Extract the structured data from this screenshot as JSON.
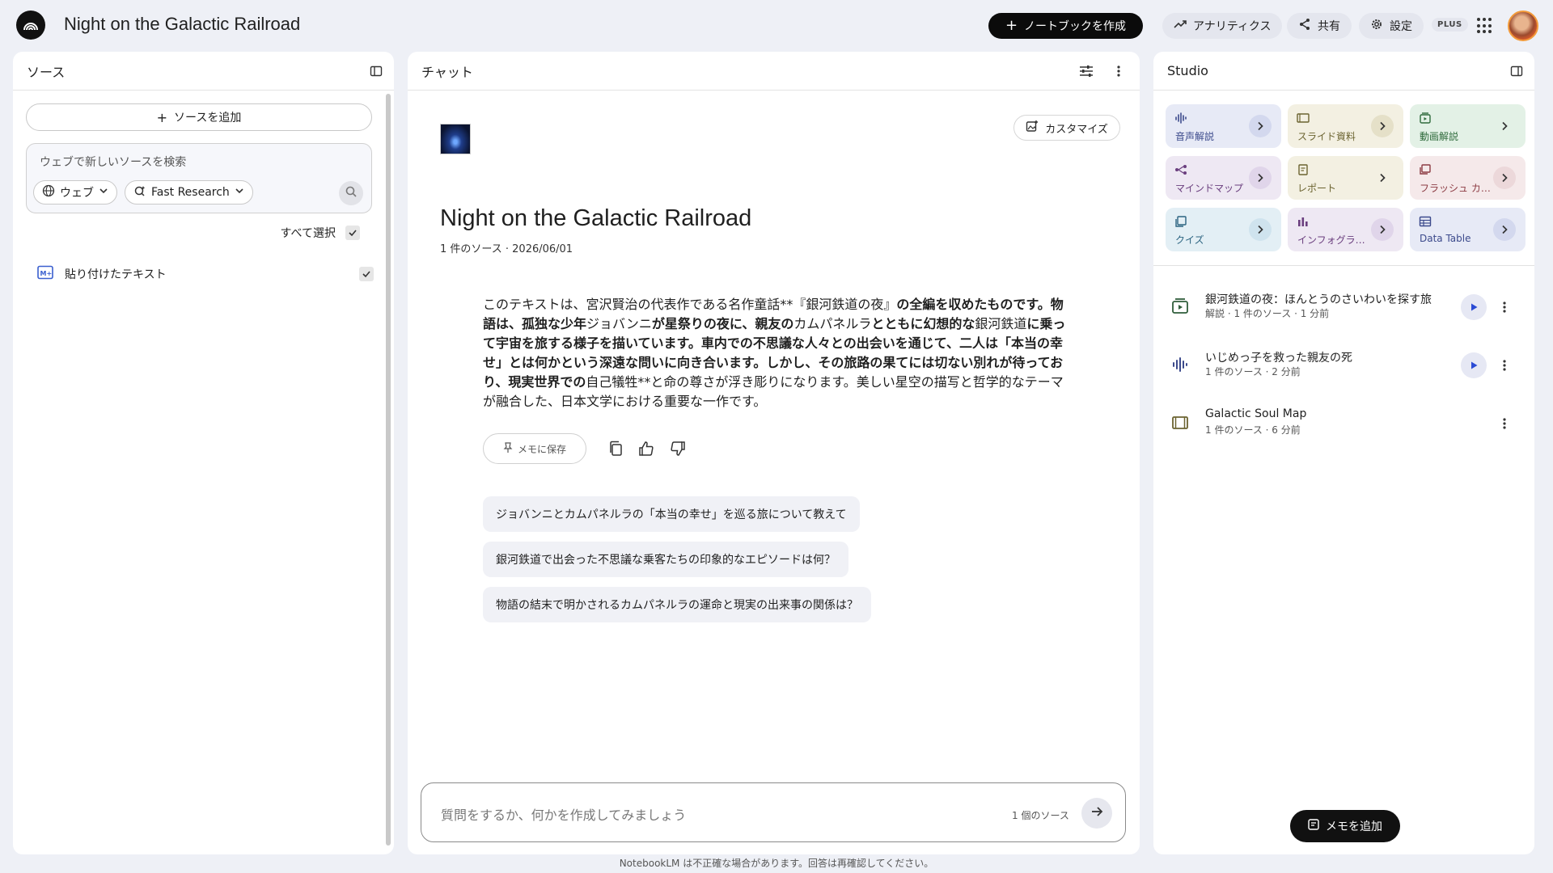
{
  "header": {
    "title": "Night on the Galactic Railroad",
    "create_label": "ノートブックを作成",
    "analytics_label": "アナリティクス",
    "share_label": "共有",
    "settings_label": "設定",
    "plan_badge": "PLUS"
  },
  "sources": {
    "panel_title": "ソース",
    "add_label": "ソースを追加",
    "search_placeholder": "ウェブで新しいソースを検索",
    "web_chip": "ウェブ",
    "research_chip": "Fast Research",
    "select_all": "すべて選択",
    "items": [
      {
        "label": "貼り付けたテキスト",
        "checked": true
      }
    ]
  },
  "chat": {
    "panel_title": "チャット",
    "customize_label": "カスタマイズ",
    "title": "Night on the Galactic Railroad",
    "meta": "1 件のソース · 2026/06/01",
    "summary_parts": [
      {
        "text": "このテキストは、宮沢賢治の代表作である名作童話**『銀河鉄道の夜』",
        "bold": false
      },
      {
        "text": "の全編を収めたものです。物語は、孤独な少年",
        "bold": true
      },
      {
        "text": "ジョバンニ",
        "bold": false
      },
      {
        "text": "が星祭りの夜に、親友の",
        "bold": true
      },
      {
        "text": "カムパネルラ",
        "bold": false
      },
      {
        "text": "とともに幻想的な",
        "bold": true
      },
      {
        "text": "銀河鉄道",
        "bold": false
      },
      {
        "text": "に乗って宇宙を旅する様子を描いています。車内での不思議な人々との出会いを通じて、二人は「本当の幸せ」とは何かという深遠な問いに向き合います。しかし、その旅路の果てには切ない別れが待っており、現実世界での",
        "bold": true
      },
      {
        "text": "自己犠牲**と命の尊さが浮き彫りになります。美しい星空の描写と哲学的なテーマが融合した、日本文学における重要な一作です。",
        "bold": false
      }
    ],
    "save_memo_label": "メモに保存",
    "suggestions": [
      "ジョバンニとカムパネルラの「本当の幸せ」を巡る旅について教えて",
      "銀河鉄道で出会った不思議な乗客たちの印象的なエピソードは何？",
      "物語の結末で明かされるカムパネルラの運命と現実の出来事の関係は？"
    ],
    "composer_placeholder": "質問をするか、何かを作成してみましょう",
    "source_count": "1 個のソース"
  },
  "studio": {
    "panel_title": "Studio",
    "tiles": [
      {
        "label": "音声解説",
        "icon": "audio-icon",
        "bg": "#e7eaf6",
        "fg": "#3c4a8c",
        "arrow_bg": "#d3d8ee"
      },
      {
        "label": "スライド資料",
        "icon": "slides-icon",
        "bg": "#f3f0e2",
        "fg": "#6b6330",
        "arrow_bg": "#e5e0c8"
      },
      {
        "label": "動画解説",
        "icon": "video-icon",
        "bg": "#e3f1e6",
        "fg": "#2f6b3c",
        "arrow_bg": "#e3f1e6"
      },
      {
        "label": "マインドマップ",
        "icon": "mindmap-icon",
        "bg": "#eee8f3",
        "fg": "#6a3e7e",
        "arrow_bg": "#e0d5ea"
      },
      {
        "label": "レポート",
        "icon": "report-icon",
        "bg": "#f3f0e2",
        "fg": "#6b6330",
        "arrow_bg": "#f3f0e2"
      },
      {
        "label": "フラッシュ カード",
        "icon": "flashcard-icon",
        "bg": "#f5e9ea",
        "fg": "#8c3b43",
        "arrow_bg": "#ecd8da"
      },
      {
        "label": "クイズ",
        "icon": "quiz-icon",
        "bg": "#e3eff5",
        "fg": "#2b6380",
        "arrow_bg": "#cfe3ee"
      },
      {
        "label": "インフォグラフィック",
        "icon": "infographic-icon",
        "bg": "#eee8f3",
        "fg": "#6a3e7e",
        "arrow_bg": "#e0d5ea"
      },
      {
        "label": "Data Table",
        "icon": "table-icon",
        "bg": "#e7eaf6",
        "fg": "#3c4a8c",
        "arrow_bg": "#d3d8ee"
      }
    ],
    "generated": [
      {
        "title": "銀河鉄道の夜：ほんとうのさいわいを探す旅",
        "subtitle": "解説 · 1 件のソース · 1 分前",
        "icon": "video-overview-icon",
        "playable": true
      },
      {
        "title": "いじめっ子を救った親友の死",
        "subtitle": "1 件のソース · 2 分前",
        "icon": "audio-overview-icon",
        "playable": true
      },
      {
        "title": "Galactic Soul Map",
        "subtitle": "1 件のソース · 6 分前",
        "icon": "slides-icon",
        "playable": false
      }
    ],
    "add_memo_label": "メモを追加"
  },
  "footer": "NotebookLM は不正確な場合があります。回答は再確認してください。"
}
